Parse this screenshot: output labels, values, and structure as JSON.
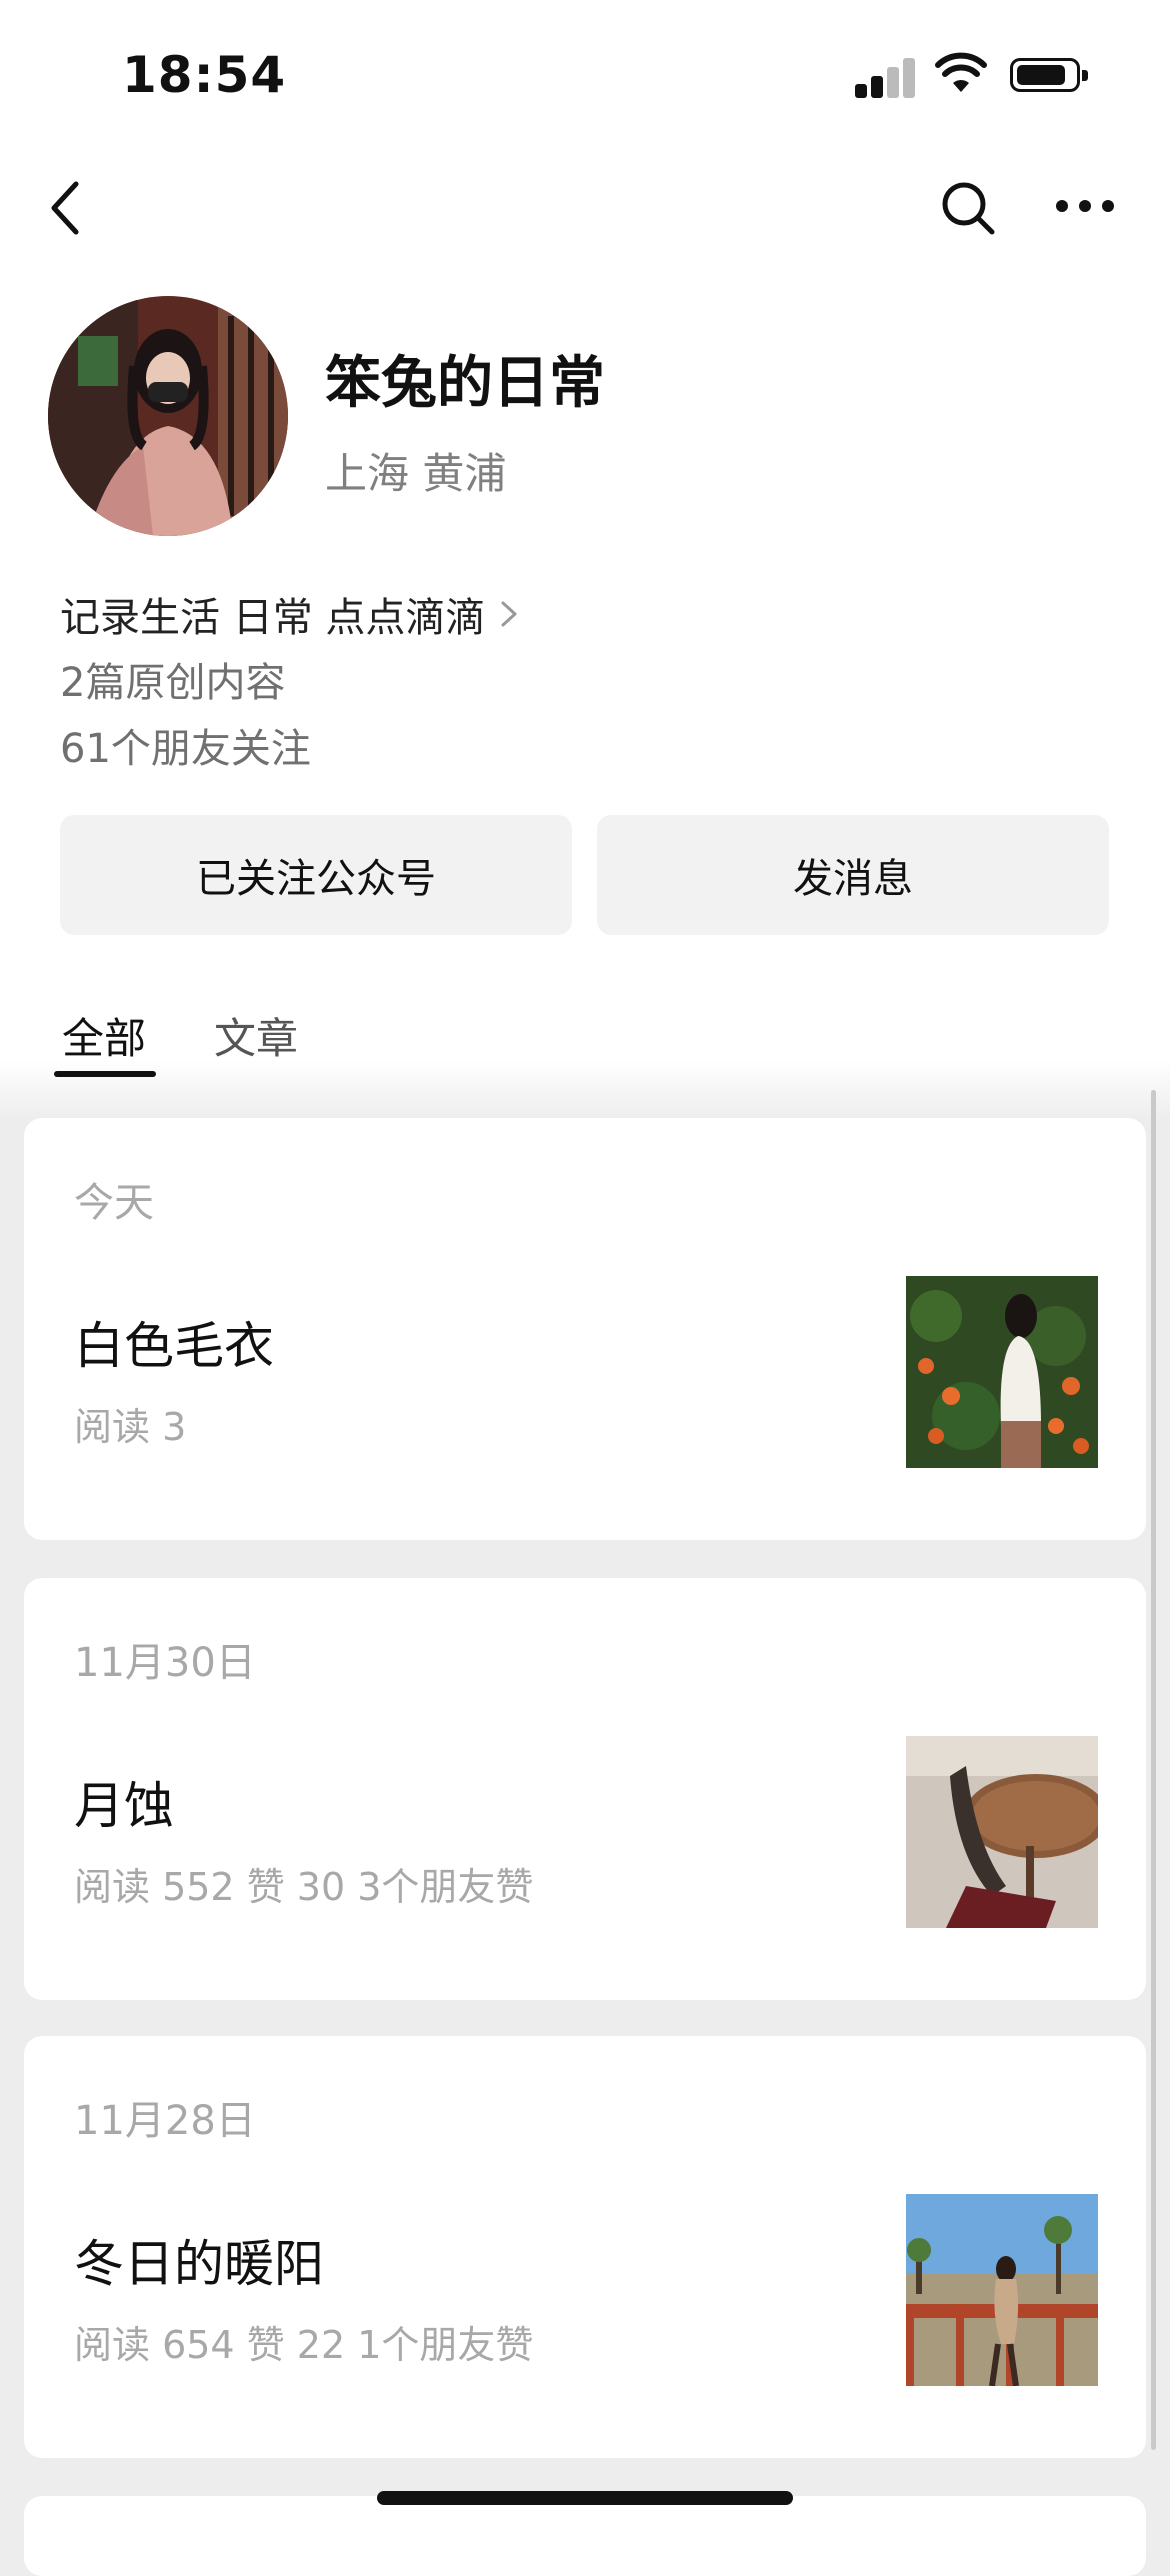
{
  "status_bar": {
    "time": "18:54"
  },
  "nav": {
    "back_icon": "chevron-left-icon",
    "search_icon": "search-icon",
    "more_icon": "more-icon"
  },
  "profile": {
    "name": "笨兔的日常",
    "location": "上海 黄浦",
    "bio": "记录生活 日常 点点滴滴",
    "original_count": "2篇原创内容",
    "friends_following": "61个朋友关注"
  },
  "actions": {
    "follow_label": "已关注公众号",
    "message_label": "发消息"
  },
  "tabs": [
    {
      "label": "全部",
      "active": true
    },
    {
      "label": "文章",
      "active": false
    }
  ],
  "articles": [
    {
      "date": "今天",
      "title": "白色毛衣",
      "stats": "阅读 3"
    },
    {
      "date": "11月30日",
      "title": "月蚀",
      "stats": "阅读 552  赞 30  3个朋友赞"
    },
    {
      "date": "11月28日",
      "title": "冬日的暖阳",
      "stats": "阅读 654  赞 22  1个朋友赞"
    }
  ],
  "colors": {
    "background": "#ededed",
    "card": "#ffffff",
    "muted": "#a8a8a8",
    "button_bg": "#f2f2f2"
  }
}
